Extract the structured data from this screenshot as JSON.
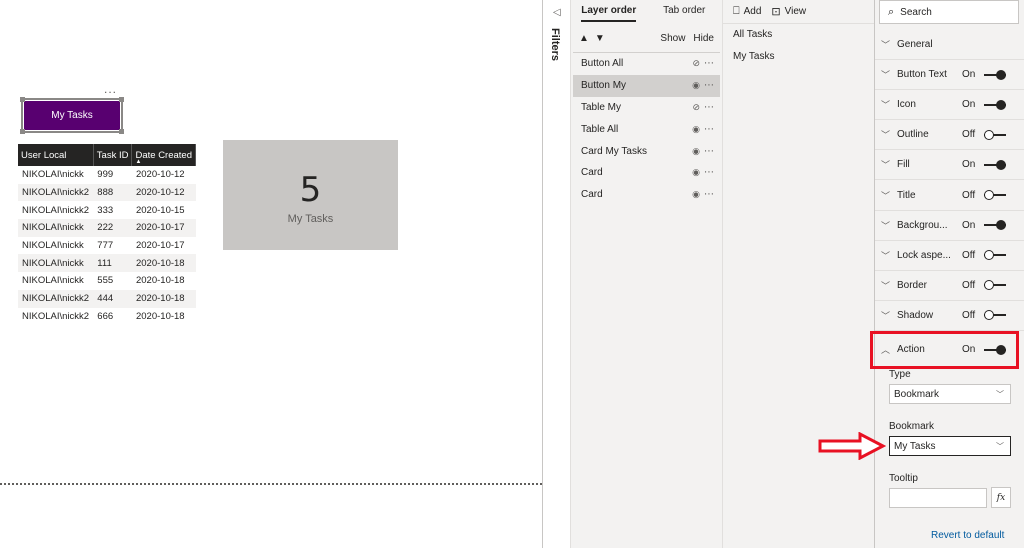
{
  "canvas": {
    "more_dots": "...",
    "button": {
      "label": "My Tasks",
      "color": "#580070"
    },
    "table": {
      "headers": [
        "User Local",
        "Task ID",
        "Date Created"
      ],
      "rows": [
        [
          "NIKOLAI\\nickk",
          "999",
          "2020-10-12"
        ],
        [
          "NIKOLAI\\nickk2",
          "888",
          "2020-10-12"
        ],
        [
          "NIKOLAI\\nickk2",
          "333",
          "2020-10-15"
        ],
        [
          "NIKOLAI\\nickk",
          "222",
          "2020-10-17"
        ],
        [
          "NIKOLAI\\nickk",
          "777",
          "2020-10-17"
        ],
        [
          "NIKOLAI\\nickk",
          "111",
          "2020-10-18"
        ],
        [
          "NIKOLAI\\nickk",
          "555",
          "2020-10-18"
        ],
        [
          "NIKOLAI\\nickk2",
          "444",
          "2020-10-18"
        ],
        [
          "NIKOLAI\\nickk2",
          "666",
          "2020-10-18"
        ]
      ]
    },
    "card": {
      "value": "5",
      "label": "My Tasks"
    }
  },
  "filters": {
    "label": "Filters"
  },
  "selection": {
    "tabs": [
      "Layer order",
      "Tab order"
    ],
    "show_label": "Show",
    "hide_label": "Hide",
    "layers": [
      {
        "name": "Button All",
        "eye": "hidden"
      },
      {
        "name": "Button My",
        "eye": "visible",
        "selected": true
      },
      {
        "name": "Table My",
        "eye": "hidden"
      },
      {
        "name": "Table All",
        "eye": "visible"
      },
      {
        "name": "Card My Tasks",
        "eye": "visible"
      },
      {
        "name": "Card",
        "eye": "visible"
      },
      {
        "name": "Card",
        "eye": "visible"
      }
    ]
  },
  "bookmarks": {
    "add_label": "Add",
    "view_label": "View",
    "items": [
      "All Tasks",
      "My Tasks"
    ]
  },
  "format": {
    "search_placeholder": "Search",
    "sections": [
      {
        "label": "General",
        "state": ""
      },
      {
        "label": "Button Text",
        "state": "On"
      },
      {
        "label": "Icon",
        "state": "On"
      },
      {
        "label": "Outline",
        "state": "Off"
      },
      {
        "label": "Fill",
        "state": "On"
      },
      {
        "label": "Title",
        "state": "Off"
      },
      {
        "label": "Backgrou...",
        "state": "On"
      },
      {
        "label": "Lock aspe...",
        "state": "Off"
      },
      {
        "label": "Border",
        "state": "Off"
      },
      {
        "label": "Shadow",
        "state": "Off"
      },
      {
        "label": "Action",
        "state": "On",
        "expanded": true
      }
    ],
    "type_label": "Type",
    "type_value": "Bookmark",
    "bookmark_label": "Bookmark",
    "bookmark_value": "My Tasks",
    "tooltip_label": "Tooltip",
    "fx_label": "fx",
    "revert_label": "Revert to default",
    "highlight_color": "#e81123"
  }
}
